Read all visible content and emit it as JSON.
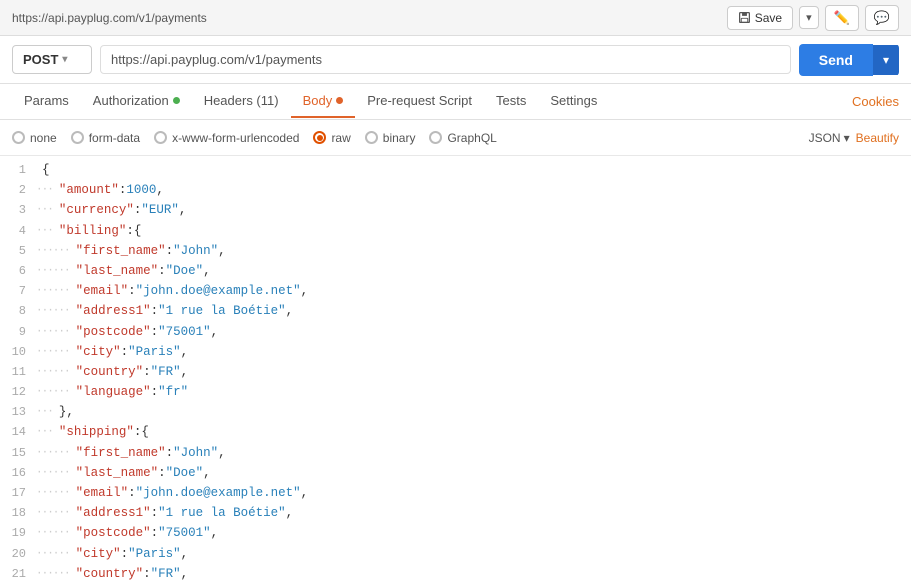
{
  "titleBar": {
    "url": "https://api.payplug.com/v1/payments",
    "saveLabel": "Save",
    "saveArrow": "▾"
  },
  "urlBar": {
    "method": "POST",
    "methodArrow": "▾",
    "url": "https://api.payplug.com/v1/payments",
    "sendLabel": "Send",
    "sendArrow": "▾"
  },
  "tabs": {
    "items": [
      {
        "id": "params",
        "label": "Params",
        "hasDot": false,
        "dotColor": "",
        "active": false
      },
      {
        "id": "authorization",
        "label": "Authorization",
        "hasDot": true,
        "dotColor": "green",
        "active": false
      },
      {
        "id": "headers",
        "label": "Headers (11)",
        "hasDot": false,
        "dotColor": "",
        "active": false
      },
      {
        "id": "body",
        "label": "Body",
        "hasDot": true,
        "dotColor": "orange",
        "active": true
      },
      {
        "id": "pre-request",
        "label": "Pre-request Script",
        "hasDot": false,
        "dotColor": "",
        "active": false
      },
      {
        "id": "tests",
        "label": "Tests",
        "hasDot": false,
        "dotColor": "",
        "active": false
      },
      {
        "id": "settings",
        "label": "Settings",
        "hasDot": false,
        "dotColor": "",
        "active": false
      }
    ],
    "rightAction": "Cookies"
  },
  "formatBar": {
    "options": [
      {
        "id": "none",
        "label": "none",
        "selected": false
      },
      {
        "id": "form-data",
        "label": "form-data",
        "selected": false
      },
      {
        "id": "x-www-form-urlencoded",
        "label": "x-www-form-urlencoded",
        "selected": false
      },
      {
        "id": "raw",
        "label": "raw",
        "selected": true
      },
      {
        "id": "binary",
        "label": "binary",
        "selected": false
      },
      {
        "id": "graphql",
        "label": "GraphQL",
        "selected": false
      }
    ],
    "jsonLabel": "JSON",
    "beautifyLabel": "Beautify"
  },
  "codeLines": [
    {
      "num": 1,
      "dots": "",
      "content": "{"
    },
    {
      "num": 2,
      "dots": "···",
      "content": "\"amount\":1000,"
    },
    {
      "num": 3,
      "dots": "···",
      "content": "\"currency\":\"EUR\","
    },
    {
      "num": 4,
      "dots": "···",
      "content": "\"billing\":{"
    },
    {
      "num": 5,
      "dots": "······",
      "content": "\"first_name\":\"John\","
    },
    {
      "num": 6,
      "dots": "······",
      "content": "\"last_name\":\"Doe\","
    },
    {
      "num": 7,
      "dots": "······",
      "content": "\"email\":\"john.doe@example.net\","
    },
    {
      "num": 8,
      "dots": "······",
      "content": "\"address1\":\"1 rue la Boétie\","
    },
    {
      "num": 9,
      "dots": "······",
      "content": "\"postcode\":\"75001\","
    },
    {
      "num": 10,
      "dots": "······",
      "content": "\"city\":\"Paris\","
    },
    {
      "num": 11,
      "dots": "······",
      "content": "\"country\":\"FR\","
    },
    {
      "num": 12,
      "dots": "······",
      "content": "\"language\":\"fr\""
    },
    {
      "num": 13,
      "dots": "···",
      "content": "},"
    },
    {
      "num": 14,
      "dots": "···",
      "content": "\"shipping\":{"
    },
    {
      "num": 15,
      "dots": "······",
      "content": "\"first_name\":\"John\","
    },
    {
      "num": 16,
      "dots": "······",
      "content": "\"last_name\":\"Doe\","
    },
    {
      "num": 17,
      "dots": "······",
      "content": "\"email\":\"john.doe@example.net\","
    },
    {
      "num": 18,
      "dots": "······",
      "content": "\"address1\":\"1 rue la Boétie\","
    },
    {
      "num": 19,
      "dots": "······",
      "content": "\"postcode\":\"75001\","
    },
    {
      "num": 20,
      "dots": "······",
      "content": "\"city\":\"Paris\","
    },
    {
      "num": 21,
      "dots": "······",
      "content": "\"country\":\"FR\","
    }
  ]
}
